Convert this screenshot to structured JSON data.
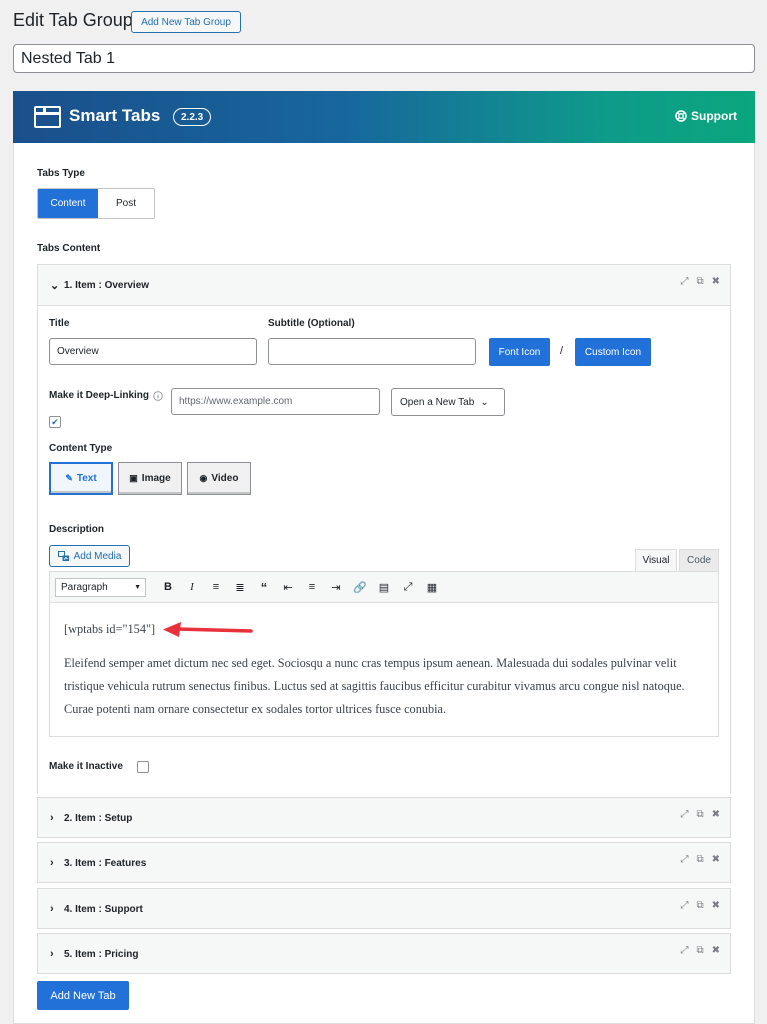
{
  "header": {
    "title": "Edit Tab Group",
    "add_new_label": "Add New Tab Group"
  },
  "post_title": "Nested Tab 1",
  "banner": {
    "brand": "Smart Tabs",
    "version": "2.2.3",
    "support_label": "Support"
  },
  "tabs_type": {
    "label": "Tabs Type",
    "options": [
      "Content",
      "Post"
    ],
    "selected": "Content"
  },
  "tabs_content_label": "Tabs Content",
  "item1": {
    "header": "1. Item : Overview",
    "title_label": "Title",
    "title_value": "Overview",
    "subtitle_label": "Subtitle (Optional)",
    "subtitle_value": "",
    "font_icon_label": "Font Icon",
    "separator": "/",
    "custom_icon_label": "Custom Icon",
    "deeplink_label": "Make it Deep-Linking",
    "url_placeholder": "https://www.example.com",
    "open_select": "Open a New Tab",
    "content_type_label": "Content Type",
    "content_types": [
      "Text",
      "Image",
      "Video"
    ],
    "description_label": "Description",
    "add_media_label": "Add Media",
    "editor_tabs": [
      "Visual",
      "Code"
    ],
    "paragraph_select": "Paragraph",
    "shortcode": "[wptabs id=\"154\"]",
    "body": "Eleifend semper amet dictum nec sed eget. Sociosqu a nunc cras tempus ipsum aenean. Malesuada dui sodales pulvinar velit tristique vehicula rutrum senectus finibus. Luctus sed at sagittis faucibus efficitur curabitur vivamus arcu congue nisl natoque. Curae potenti nam ornare consectetur ex sodales tortor ultrices fusce conubia.",
    "inactive_label": "Make it Inactive"
  },
  "items": [
    "2. Item : Setup",
    "3. Item : Features",
    "4. Item : Support",
    "5. Item : Pricing"
  ],
  "add_new_tab_label": "Add New Tab",
  "colors": {
    "primary": "#2271d8",
    "banner_start": "#1a4f8b",
    "banner_end": "#0aa67d",
    "arrow": "#e8313a"
  }
}
